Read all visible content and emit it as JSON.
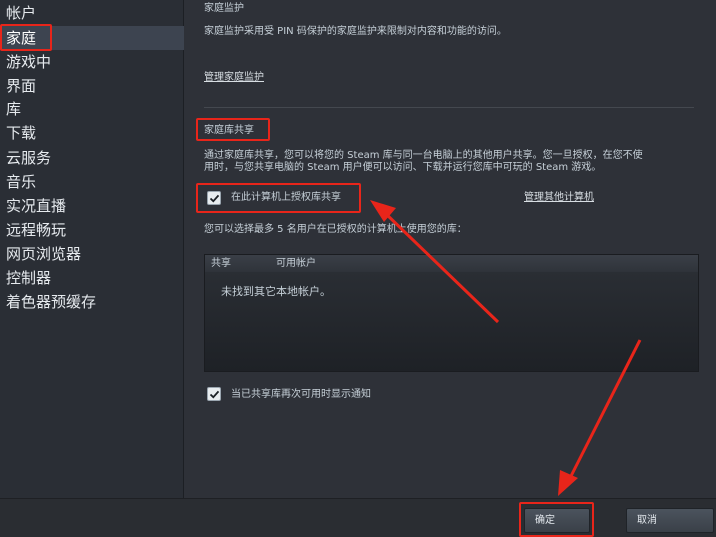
{
  "sidebar": {
    "items": [
      {
        "label": "帐户"
      },
      {
        "label": "家庭"
      },
      {
        "label": "游戏中"
      },
      {
        "label": "界面"
      },
      {
        "label": "库"
      },
      {
        "label": "下载"
      },
      {
        "label": "云服务"
      },
      {
        "label": "音乐"
      },
      {
        "label": "实况直播"
      },
      {
        "label": "远程畅玩"
      },
      {
        "label": "网页浏览器"
      },
      {
        "label": "控制器"
      },
      {
        "label": "着色器预缓存"
      }
    ]
  },
  "family_view": {
    "title": "家庭监护",
    "description": "家庭监护采用受 PIN 码保护的家庭监护来限制对内容和功能的访问。",
    "manage_link": "管理家庭监护"
  },
  "library_sharing": {
    "title": "家庭库共享",
    "description_line1": "通过家庭库共享，您可以将您的 Steam 库与同一台电脑上的其他用户共享。您一旦授权，在您不使",
    "description_line2": "用时，与您共享电脑的 Steam 用户便可以访问、下载并运行您库中可玩的 Steam 游戏。",
    "authorize_label": "在此计算机上授权库共享",
    "authorize_checked": true,
    "manage_other_link": "管理其他计算机",
    "select_hint": "您可以选择最多 5 名用户在已授权的计算机上使用您的库：",
    "table": {
      "columns": [
        "共享",
        "可用帐户"
      ],
      "empty_message": "未找到其它本地帐户。"
    },
    "notify_label": "当已共享库再次可用时显示通知",
    "notify_checked": true
  },
  "footer": {
    "ok_label": "确定",
    "cancel_label": "取消"
  },
  "colors": {
    "annotation_red": "#e8251a",
    "sidebar_active_bg": "#3d4450"
  }
}
